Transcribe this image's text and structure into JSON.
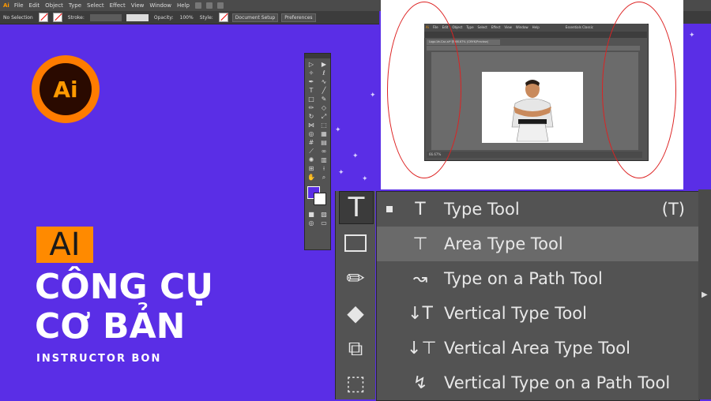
{
  "app": {
    "logo": "Ai",
    "menu": [
      "File",
      "Edit",
      "Object",
      "Type",
      "Select",
      "Effect",
      "View",
      "Window",
      "Help"
    ]
  },
  "options_bar": {
    "selection": "No Selection",
    "stroke_label": "Stroke:",
    "opacity_label": "Opacity:",
    "opacity_value": "100%",
    "style_label": "Style:",
    "document_setup": "Document Setup",
    "preferences": "Preferences"
  },
  "title": {
    "tag": "AI",
    "line1": "CÔNG CỤ",
    "line2": "CƠ BẢN",
    "instructor": "INSTRUCTOR BON"
  },
  "screenshot": {
    "tab": "Logo-Ve-Cac.ai* @ 66.67% (CMYK/Preview)",
    "zoom": "66.67%",
    "essentials": "Essentials Classic"
  },
  "flyout": {
    "items": [
      {
        "icon": "T",
        "label": "Type Tool",
        "shortcut": "(T)",
        "selected": true
      },
      {
        "icon": "⊤",
        "label": "Area Type Tool",
        "shortcut": "",
        "selected": false
      },
      {
        "icon": "↝",
        "label": "Type on a Path Tool",
        "shortcut": "",
        "selected": false
      },
      {
        "icon": "↓T",
        "label": "Vertical Type Tool",
        "shortcut": "",
        "selected": false
      },
      {
        "icon": "↓⊤",
        "label": "Vertical Area Type Tool",
        "shortcut": "",
        "selected": false
      },
      {
        "icon": "↯",
        "label": "Vertical Type on a Path Tool",
        "shortcut": "",
        "selected": false
      }
    ]
  },
  "colors": {
    "background": "#5a2ee6",
    "accent": "#ff8a00",
    "panel": "#535353"
  }
}
